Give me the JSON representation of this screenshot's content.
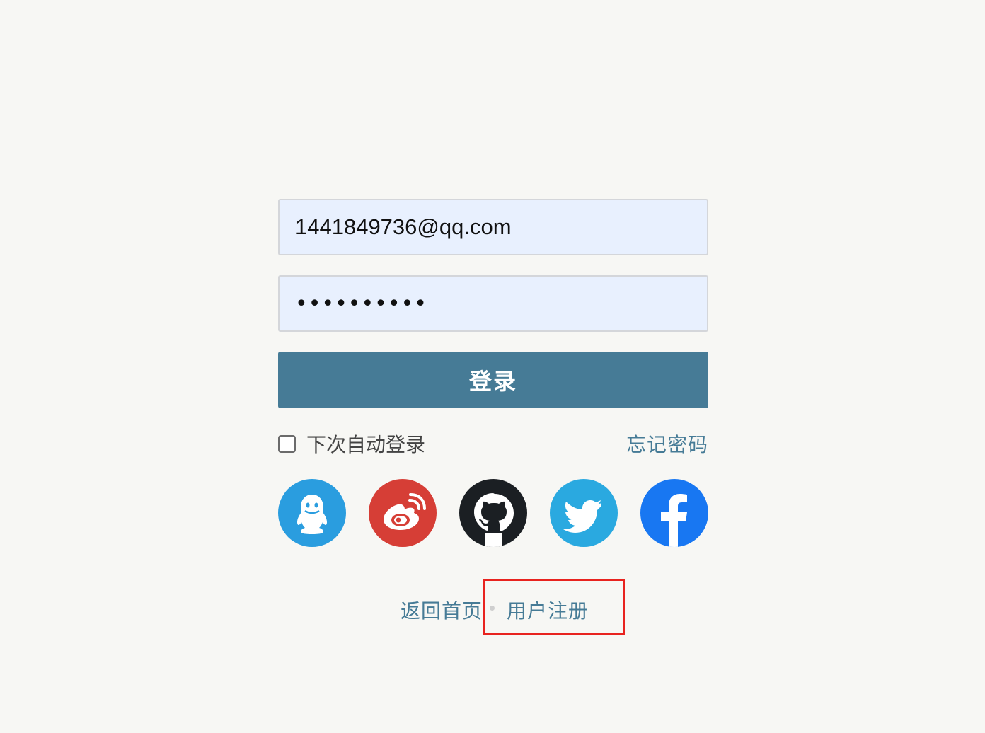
{
  "login_form": {
    "email_value": "1441849736@qq.com",
    "password_mask": "••••••••••",
    "login_button_label": "登录",
    "remember_label": "下次自动登录",
    "remember_checked": false,
    "forgot_label": "忘记密码"
  },
  "social_logins": [
    {
      "icon": "qq-icon",
      "color": "#2a9ddf"
    },
    {
      "icon": "weibo-icon",
      "color": "#d63e36"
    },
    {
      "icon": "github-icon",
      "color": "#1b1f23"
    },
    {
      "icon": "twitter-icon",
      "color": "#2aa9e0"
    },
    {
      "icon": "facebook-icon",
      "color": "#1877f2"
    }
  ],
  "footer": {
    "back_home_label": "返回首页",
    "register_label": "用户注册"
  },
  "colors": {
    "accent": "#467b96",
    "background": "#f7f7f4",
    "input_background": "#e8f0fe",
    "highlight": "#e8231f"
  }
}
